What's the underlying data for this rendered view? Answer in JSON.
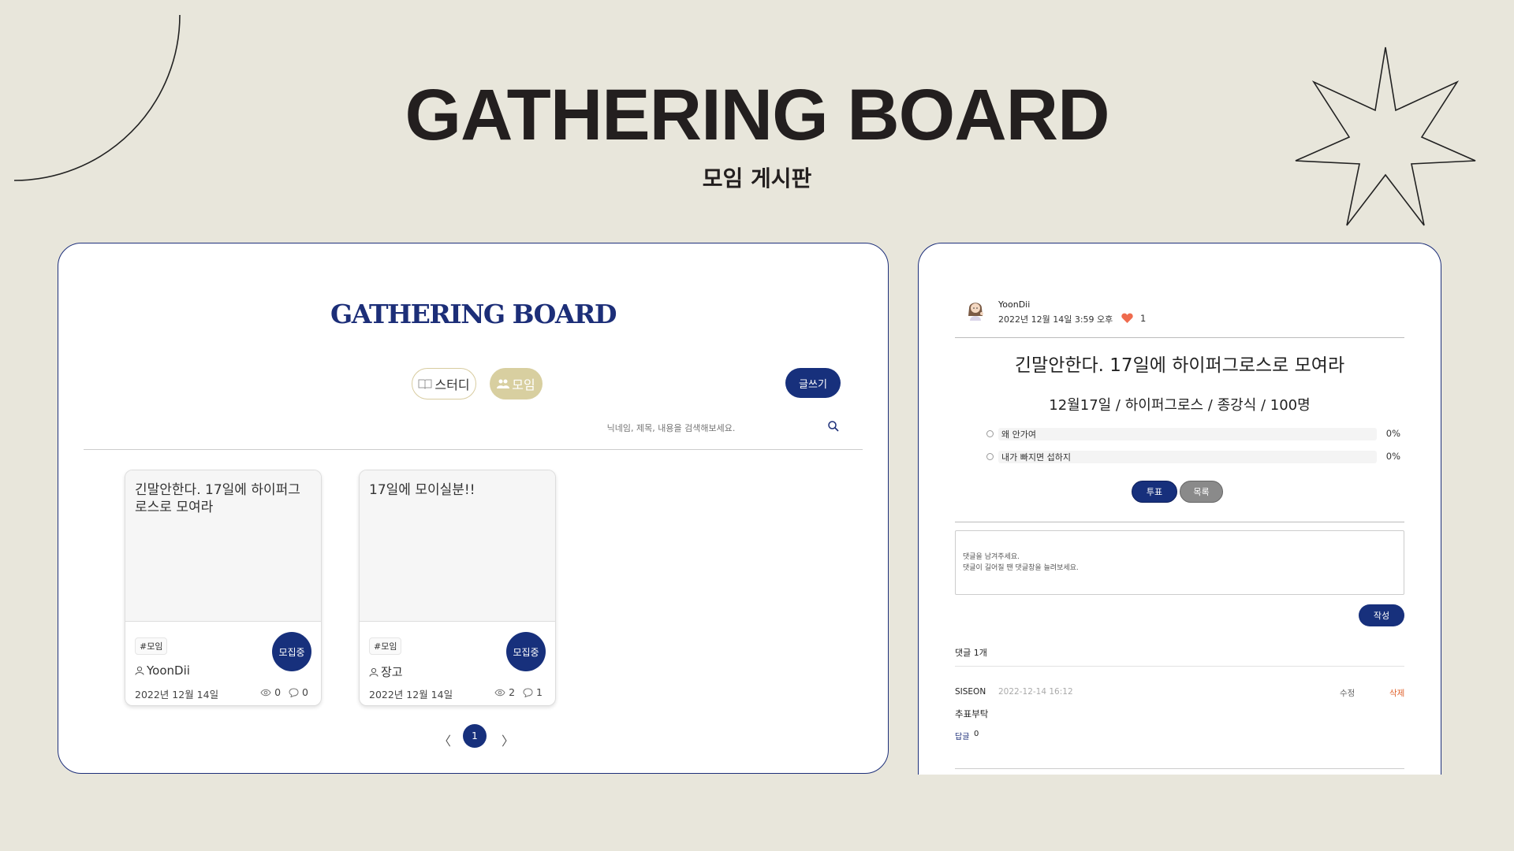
{
  "hero": {
    "title": "GATHERING BOARD",
    "subtitle": "모임 게시판"
  },
  "list": {
    "logo": "GATHERING BOARD",
    "categories": [
      {
        "label": "스터디",
        "icon": "book-icon"
      },
      {
        "label": "모임",
        "icon": "people-icon",
        "active": true
      }
    ],
    "write_label": "글쓰기",
    "search_placeholder": "닉네임, 제목, 내용을 검색해보세요.",
    "cards": [
      {
        "title": "긴말안한다. 17일에 하이퍼그로스로 모여라",
        "tag": "#모임",
        "author": "YoonDii",
        "date": "2022년 12월 14일",
        "views": "0",
        "comments": "0",
        "status": "모집중"
      },
      {
        "title": "17일에 모이실분!!",
        "tag": "#모임",
        "author": "장고",
        "date": "2022년 12월 14일",
        "views": "2",
        "comments": "1",
        "status": "모집중"
      }
    ],
    "pagination": {
      "prev": "〈",
      "current": "1",
      "next": "〉"
    }
  },
  "detail": {
    "author": "YoonDii",
    "date": "2022년 12월 14일 3:59 오후",
    "likes": "1",
    "title": "긴말안한다. 17일에 하이퍼그로스로 모여라",
    "summary": "12월17일 / 하이퍼그로스 / 종강식 / 100명",
    "poll": [
      {
        "label": "왜 안가여",
        "percent": "0%"
      },
      {
        "label": "내가 빠지면 섭하지",
        "percent": "0%"
      }
    ],
    "vote_label": "투표",
    "list_label": "목록",
    "comment_placeholder": "댓글을 남겨주세요.\n댓글이 길어질 땐 댓글창을 늘려보세요.",
    "submit_label": "작성",
    "comment_count": "댓글 1개",
    "comments": [
      {
        "author": "SISEON",
        "date": "2022-12-14 16:12",
        "edit": "수정",
        "delete": "삭제",
        "body": "추표부탁",
        "reply_label": "답글",
        "reply_count": "0"
      }
    ]
  },
  "colors": {
    "background": "#e8e6db",
    "navy": "#17307c",
    "category_active": "#d8cfa0",
    "heart": "#ef6b4e",
    "delete": "#e0632e"
  }
}
